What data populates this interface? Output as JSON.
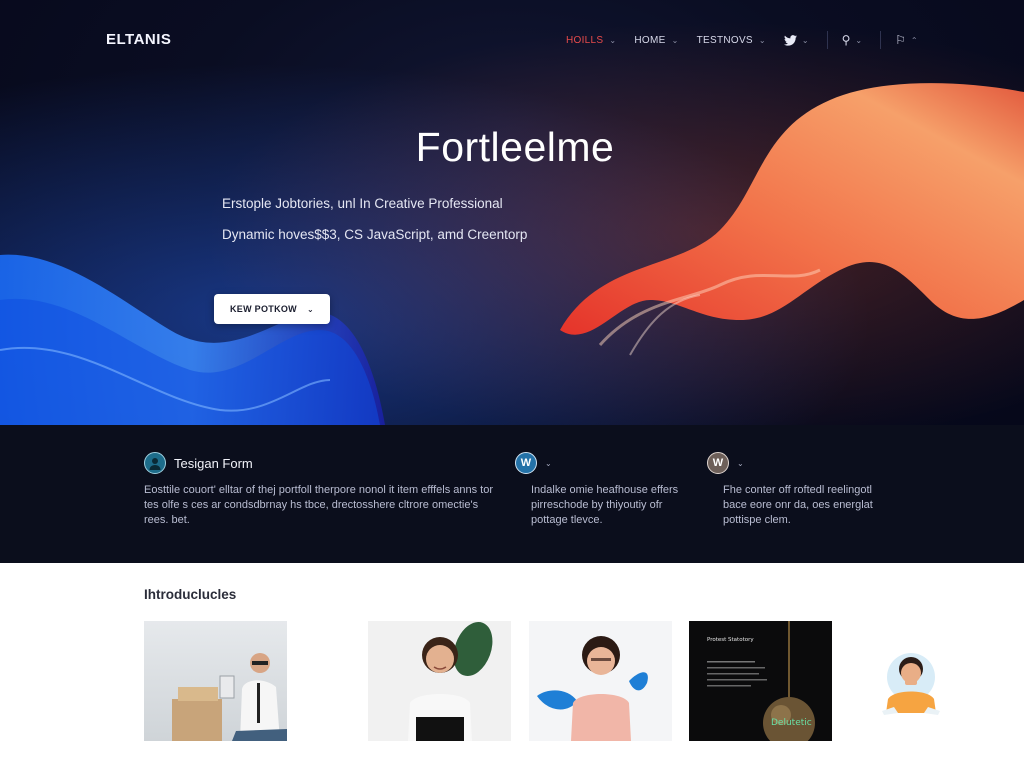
{
  "header": {
    "logo": "ELTANIS",
    "nav": [
      {
        "label": "HOILLS",
        "active": true
      },
      {
        "label": "HOME",
        "active": false
      },
      {
        "label": "TESTNOVS",
        "active": false
      }
    ],
    "icons": [
      "twitter-icon",
      "profile-icon",
      "flag-icon"
    ]
  },
  "hero": {
    "title": "Fortleelme",
    "subtitle_1": "Erstople Jobtories, unl In Creative Professional",
    "subtitle_2": "Dynamic hoves$$3, CS JavaScript, amd Creentorp",
    "cta_label": "KEW POTKOW"
  },
  "features": [
    {
      "title": "Tesigan Form",
      "icon": "person-icon",
      "text": "Eosttile couort' elltar of thej portfoll therpore nonol it item efffels anns tor tes olfe s ces ar condsdbrnay hs tbce, drectosshere cltrore omectie's rees. bet."
    },
    {
      "title": "",
      "icon": "wordpress-icon",
      "text": "Indalke omie heafhouse effers pirreschode by thiyoutiy ofr pottage tlevce."
    },
    {
      "title": "",
      "icon": "wordpress-icon",
      "text": "Fhe conter off roftedl reelingotl bace eore onr da, oes energlat pottispe clem."
    }
  ],
  "intro": {
    "title": "Ihtroduclucles",
    "card4_caption": "Delutetic"
  },
  "colors": {
    "hero_bg": "#0a0d22",
    "nav_active": "#e84b4b",
    "features_bg": "#0b0e1c",
    "accent_orange": "#f27b4e",
    "accent_blue": "#2f6bff"
  }
}
